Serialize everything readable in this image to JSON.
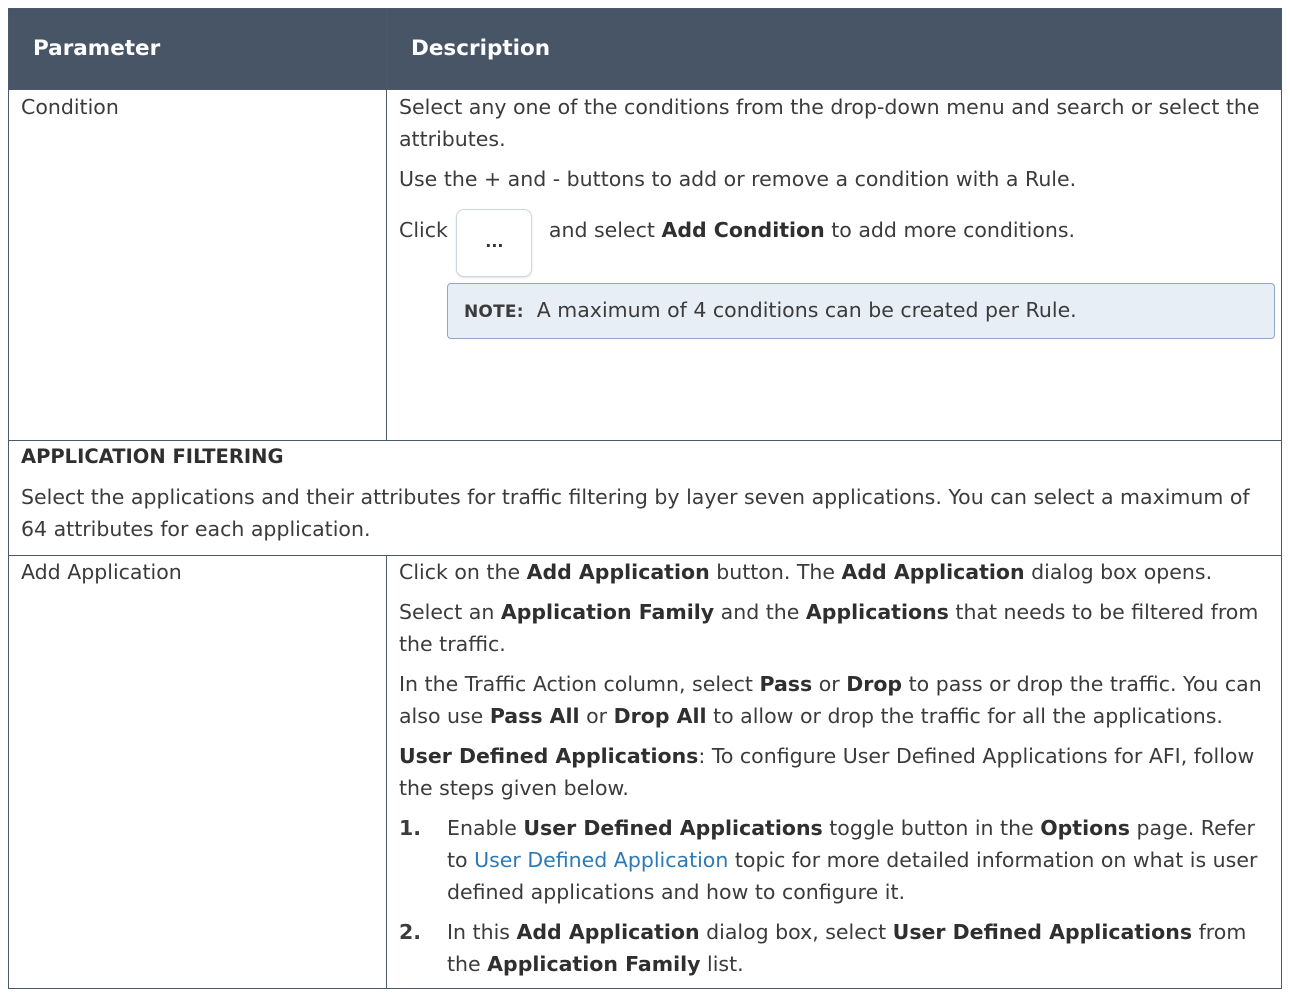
{
  "header": {
    "parameter": "Parameter",
    "description": "Description"
  },
  "condition": {
    "param": "Condition",
    "p1": "Select any one of the conditions from the drop-down menu and search or select the attributes.",
    "p2": "Use the + and - buttons to add or remove a condition with a Rule.",
    "click_pre": "Click",
    "more_button": "...",
    "click_mid": "and select",
    "add_condition": "Add Condition",
    "click_post": "to add more conditions.",
    "note_label": "NOTE:",
    "note_text": "A maximum of 4 conditions can be created per Rule."
  },
  "app_filtering": {
    "title": "APPLICATION FILTERING",
    "desc": "Select the applications and their attributes for traffic filtering by layer seven applications. You can select a maximum of 64 attributes for each application."
  },
  "add_application": {
    "param": "Add Application",
    "p1": [
      "Click on the ",
      "Add Application",
      " button. The ",
      "Add Application",
      " dialog box opens."
    ],
    "p2": [
      "Select an ",
      "Application Family",
      " and the ",
      "Applications",
      " that needs to be filtered from the traffic."
    ],
    "p3": [
      "In the Traffic Action column, select ",
      "Pass",
      " or ",
      "Drop",
      " to pass or drop the traffic. You can also use ",
      "Pass All",
      " or ",
      "Drop All",
      " to allow or drop the traffic for all the applications."
    ],
    "p4": [
      "User Defined Applications",
      ": To configure User Defined Applications for AFI, follow the steps given below."
    ],
    "steps": [
      {
        "num": "1.",
        "parts": [
          "Enable ",
          "User Defined Applications",
          " toggle button in the ",
          "Options",
          " page. Refer to ",
          "User Defined Application",
          " topic for more detailed information on what is user defined applications and how to configure it."
        ]
      },
      {
        "num": "2.",
        "parts": [
          "In this ",
          "Add Application",
          " dialog box, select ",
          "User Defined Applications",
          " from the ",
          "Application Family",
          " list."
        ]
      }
    ]
  }
}
